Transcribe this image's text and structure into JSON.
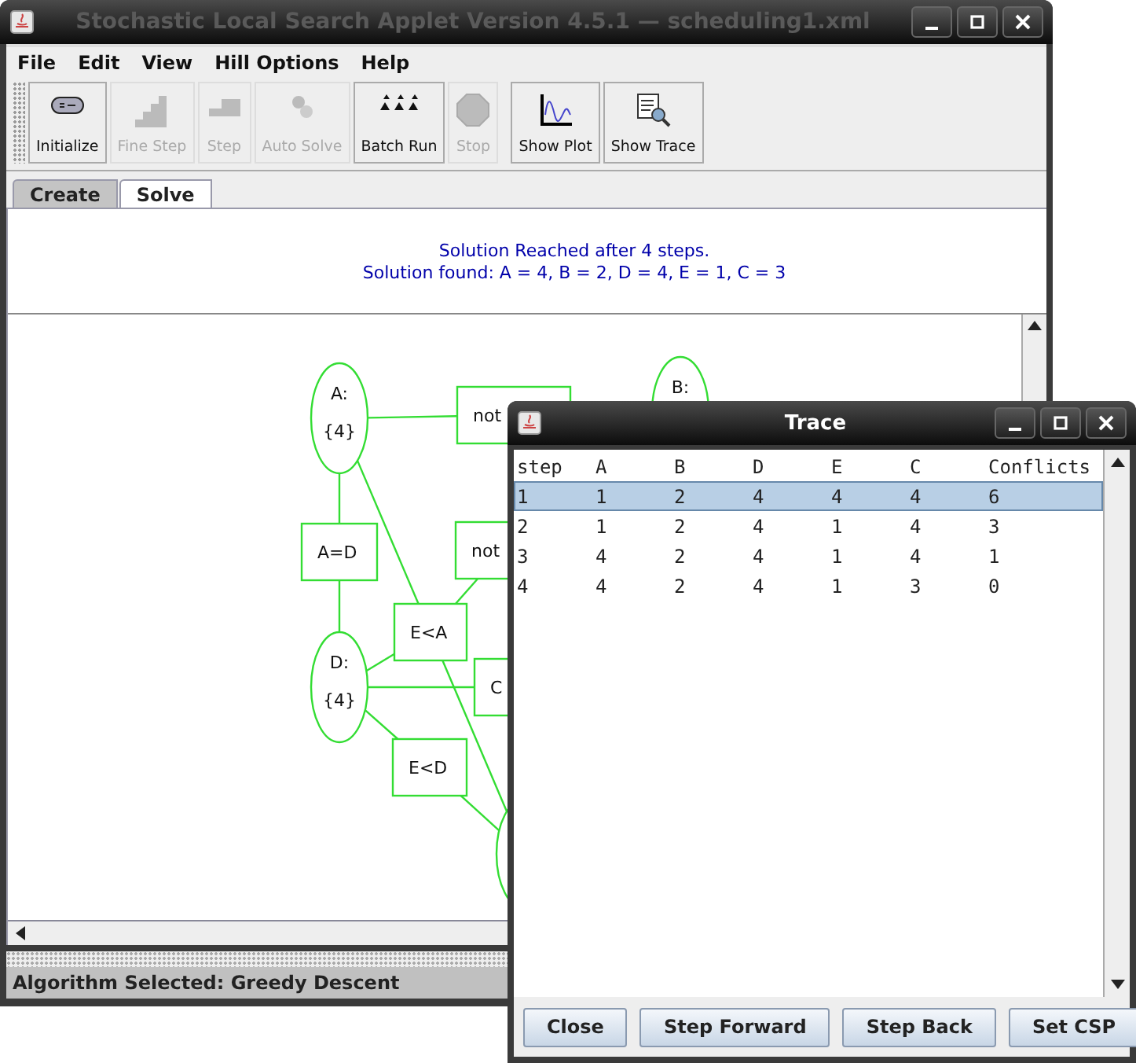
{
  "window": {
    "title": "Stochastic Local Search Applet Version 4.5.1 — scheduling1.xml"
  },
  "menu": [
    {
      "label": "File"
    },
    {
      "label": "Edit"
    },
    {
      "label": "View"
    },
    {
      "label": "Hill Options"
    },
    {
      "label": "Help"
    }
  ],
  "toolbar": [
    {
      "label": "Initialize",
      "disabled": false
    },
    {
      "label": "Fine Step",
      "disabled": true
    },
    {
      "label": "Step",
      "disabled": true
    },
    {
      "label": "Auto Solve",
      "disabled": true
    },
    {
      "label": "Batch Run",
      "disabled": false
    },
    {
      "label": "Stop",
      "disabled": true
    },
    {
      "label": "Show Plot",
      "disabled": false
    },
    {
      "label": "Show Trace",
      "disabled": false
    }
  ],
  "tabs": [
    {
      "label": "Create",
      "selected": false
    },
    {
      "label": "Solve",
      "selected": true
    }
  ],
  "messages": [
    "Solution Reached after 4 steps.",
    "Solution found:  A = 4, B = 2, D = 4, E = 1, C = 3"
  ],
  "graph": {
    "nodes": [
      {
        "kind": "variable",
        "name": "A:",
        "domain": "{4}"
      },
      {
        "kind": "variable",
        "name": "B:"
      },
      {
        "kind": "variable",
        "name": "D:",
        "domain": "{4}"
      },
      {
        "kind": "variable"
      },
      {
        "kind": "constraint",
        "label": "not"
      },
      {
        "kind": "constraint",
        "label": "A=D"
      },
      {
        "kind": "constraint",
        "label": "not"
      },
      {
        "kind": "constraint",
        "label": "E<A"
      },
      {
        "kind": "constraint",
        "label": "C"
      },
      {
        "kind": "constraint",
        "label": "E<D"
      }
    ]
  },
  "status_bar": "Algorithm Selected:  Greedy Descent",
  "trace": {
    "title": "Trace",
    "columns": [
      "step",
      "A",
      "B",
      "D",
      "E",
      "C",
      "Conflicts"
    ],
    "rows": [
      {
        "cells": [
          "1",
          "1",
          "2",
          "4",
          "4",
          "4",
          "6"
        ],
        "selected": true
      },
      {
        "cells": [
          "2",
          "1",
          "2",
          "4",
          "1",
          "4",
          "3"
        ],
        "selected": false
      },
      {
        "cells": [
          "3",
          "4",
          "2",
          "4",
          "1",
          "4",
          "1"
        ],
        "selected": false
      },
      {
        "cells": [
          "4",
          "4",
          "2",
          "4",
          "1",
          "3",
          "0"
        ],
        "selected": false
      }
    ],
    "buttons": [
      "Close",
      "Step Forward",
      "Step Back",
      "Set CSP"
    ]
  }
}
